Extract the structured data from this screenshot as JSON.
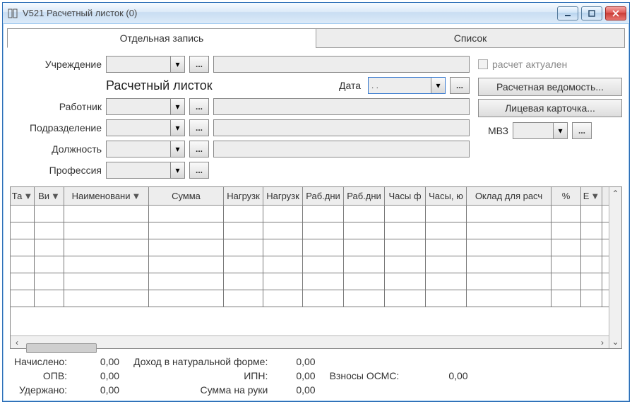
{
  "window": {
    "title": "V521 Расчетный листок (0)"
  },
  "tabs": {
    "individual": "Отдельная запись",
    "list": "Список"
  },
  "labels": {
    "institution": "Учреждение",
    "heading": "Расчетный листок",
    "date": "Дата",
    "employee": "Работник",
    "department": "Подразделение",
    "position": "Должность",
    "profession": "Профессия",
    "mvz": "МВЗ"
  },
  "date_value": ".  .",
  "checkbox": {
    "actual": "расчет актуален"
  },
  "buttons": {
    "payroll": "Расчетная ведомость...",
    "card": "Лицевая карточка...",
    "ell": "..."
  },
  "columns": [
    "Та",
    "Ви",
    "Наименовани",
    "Сумма",
    "Нагрузк",
    "Нагрузк",
    "Раб.дни",
    "Раб.дни",
    "Часы ф",
    "Часы, ю",
    "Оклад для расч",
    "%",
    "Е"
  ],
  "totals": {
    "accrued_k": "Начислено:",
    "accrued_v": "0,00",
    "opv_k": "ОПВ:",
    "opv_v": "0,00",
    "withheld_k": "Удержано:",
    "withheld_v": "0,00",
    "inkind_k": "Доход в натуральной форме:",
    "inkind_v": "0,00",
    "ipn_k": "ИПН:",
    "ipn_v": "0,00",
    "net_k": "Сумма на руки",
    "net_v": "0,00",
    "osms_k": "Взносы ОСМС:",
    "osms_v": "0,00"
  }
}
